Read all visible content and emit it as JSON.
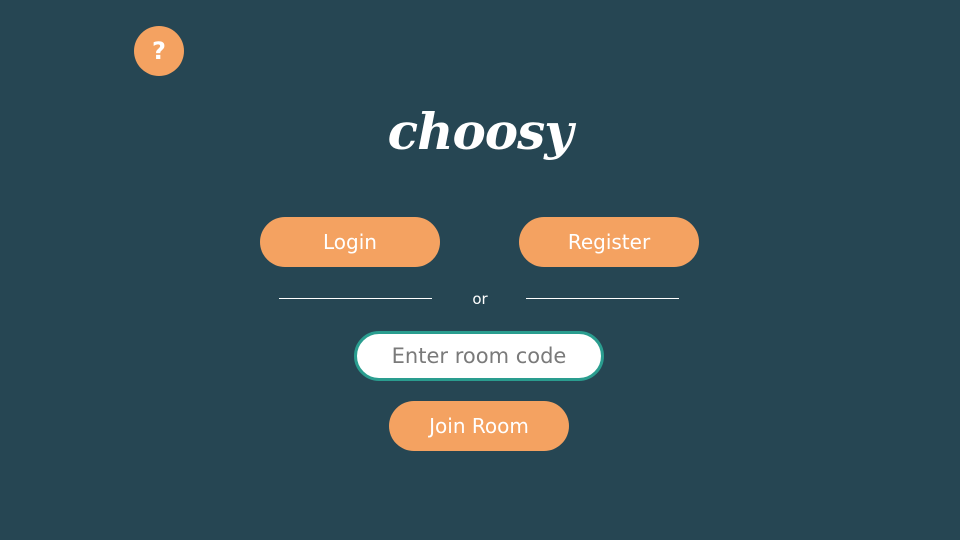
{
  "help": {
    "icon": "question-mark-icon",
    "glyph": "?"
  },
  "app": {
    "logo_text": "choosy"
  },
  "auth": {
    "login_label": "Login",
    "register_label": "Register"
  },
  "divider": {
    "text": "or"
  },
  "room": {
    "placeholder": "Enter room code",
    "value": "",
    "join_label": "Join Room"
  },
  "colors": {
    "background": "#264653",
    "accent": "#f4a261",
    "input_border": "#2a9d8f",
    "text_light": "#ffffff"
  }
}
